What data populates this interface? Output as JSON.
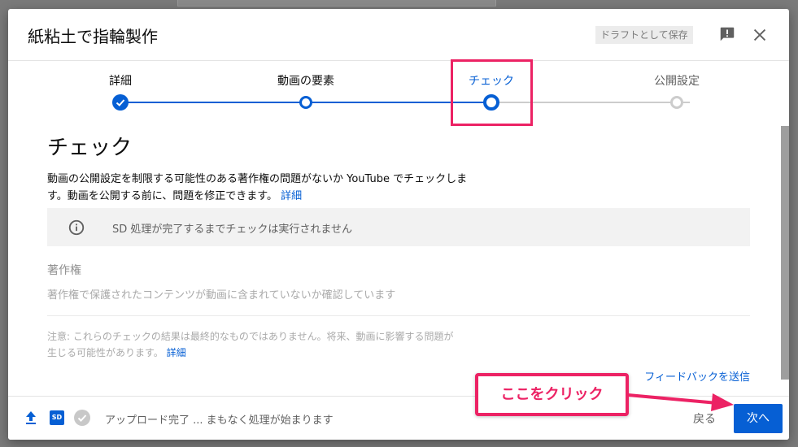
{
  "dialog": {
    "title": "紙粘土で指輪製作",
    "draft_label": "ドラフトとして保存",
    "feedback_icon": "feedback-icon",
    "close_icon": "close-icon"
  },
  "stepper": {
    "steps": [
      {
        "label": "詳細",
        "state": "done"
      },
      {
        "label": "動画の要素",
        "state": "visited"
      },
      {
        "label": "チェック",
        "state": "current"
      },
      {
        "label": "公開設定",
        "state": "pending"
      }
    ]
  },
  "check": {
    "heading": "チェック",
    "description": "動画の公開設定を制限する可能性のある著作権の問題がないか YouTube でチェックします。動画を公開する前に、問題を修正できます。",
    "description_link": "詳細",
    "info_text": "SD 処理が完了するまでチェックは実行されません",
    "copyright_title": "著作権",
    "copyright_desc": "著作権で保護されたコンテンツが動画に含まれていないか確認しています",
    "note": "注意: これらのチェックの結果は最終的なものではありません。将来、動画に影響する問題が生じる可能性があります。",
    "note_link": "詳細",
    "feedback_link": "フィードバックを送信"
  },
  "footer": {
    "sd_badge": "SD",
    "status": "アップロード完了 ... まもなく処理が始まります",
    "back_label": "戻る",
    "next_label": "次へ"
  },
  "annotation": {
    "callout_text": "ここをクリック"
  },
  "colors": {
    "accent": "#065fd4",
    "highlight": "#ec2264"
  }
}
